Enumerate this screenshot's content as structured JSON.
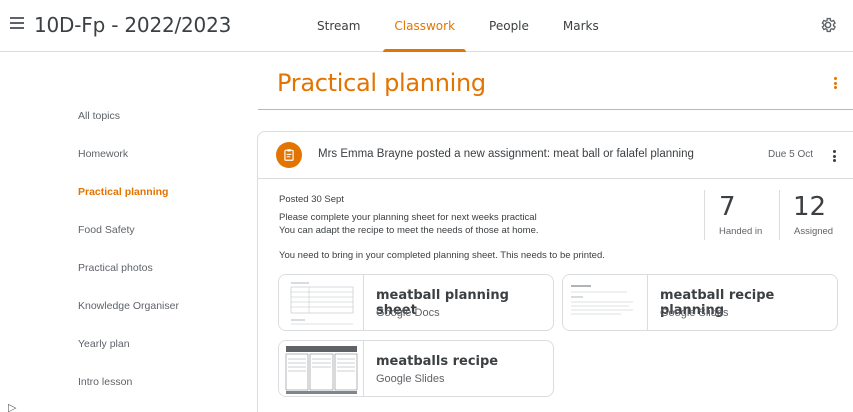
{
  "header": {
    "class_title": "10D-Fp - 2022/2023",
    "tabs": [
      {
        "label": "Stream"
      },
      {
        "label": "Classwork"
      },
      {
        "label": "People"
      },
      {
        "label": "Marks"
      }
    ],
    "active_tab": "Classwork",
    "icons": {
      "menu": "hamburger-menu-icon",
      "settings": "gear-icon"
    }
  },
  "sidebar": {
    "items": [
      {
        "label": "All topics"
      },
      {
        "label": "Homework"
      },
      {
        "label": "Practical planning"
      },
      {
        "label": "Food Safety"
      },
      {
        "label": "Practical photos"
      },
      {
        "label": "Knowledge Organiser"
      },
      {
        "label": "Yearly plan"
      },
      {
        "label": "Intro lesson"
      }
    ],
    "active_item": "Practical planning"
  },
  "topic": {
    "title": "Practical planning"
  },
  "assignment": {
    "posted_by": "Mrs Emma Brayne posted a new assignment: meat ball or falafel planning",
    "due": "Due 5 Oct",
    "posted_date": "Posted 30 Sept",
    "description_lines": [
      "Please complete your planning sheet for next weeks practical",
      "You can adapt the recipe to meet the needs of those at home.",
      "You need to bring in your completed planning sheet. This needs to be printed."
    ],
    "stats": {
      "handed_in": {
        "count": "7",
        "label": "Handed in"
      },
      "assigned": {
        "count": "12",
        "label": "Assigned"
      }
    },
    "attachments": [
      {
        "title": "meatball planning sheet",
        "type": "Google Docs"
      },
      {
        "title": "meatball recipe planning",
        "type": "Google Slides"
      },
      {
        "title": "meatballs recipe",
        "type": "Google Slides"
      }
    ]
  },
  "colors": {
    "accent": "#e37400",
    "text": "#3c4043",
    "muted": "#5f6368",
    "border": "#dadce0"
  }
}
